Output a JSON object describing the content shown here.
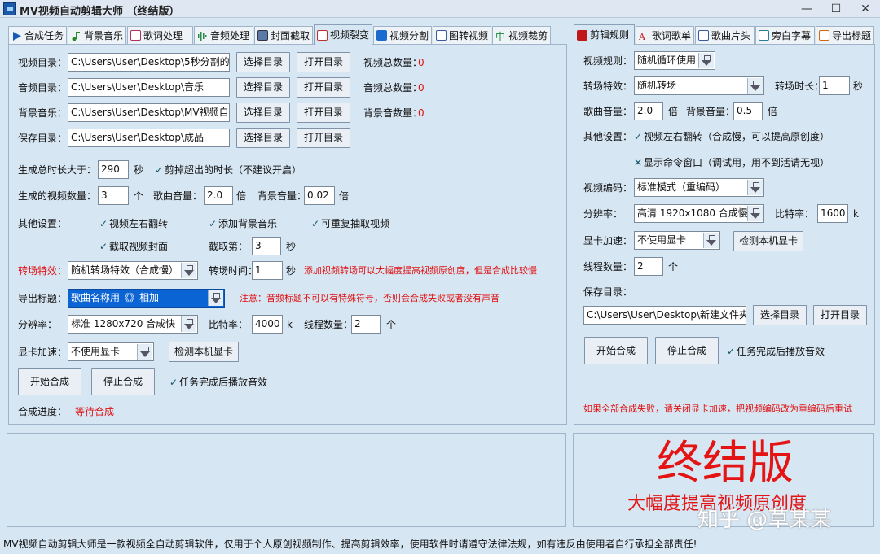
{
  "window": {
    "title": "MV视频自动剪辑大师 （终结版）",
    "min": "—",
    "max": "☐",
    "close": "✕"
  },
  "left_tabs": [
    "合成任务",
    "背景音乐",
    "歌词处理",
    "音频处理",
    "封面截取",
    "视频裂变",
    "视频分割",
    "图转视频",
    "视频裁剪"
  ],
  "right_tabs": [
    "剪辑规则",
    "歌词歌单",
    "歌曲片头",
    "旁白字幕",
    "导出标题"
  ],
  "colors": {
    "accent_red": "#e01010",
    "panel_bg": "#d7e6f3",
    "selection": "#0a64d4"
  },
  "left": {
    "video_dir_label": "视频目录：",
    "video_dir": "C:\\Users\\User\\Desktop\\5秒分割的视",
    "audio_dir_label": "音频目录：",
    "audio_dir": "C:\\Users\\User\\Desktop\\音乐",
    "bg_music_label": "背景音乐：",
    "bg_music_dir": "C:\\Users\\User\\Desktop\\MV视频自动",
    "save_dir_label": "保存目录：",
    "save_dir": "C:\\Users\\User\\Desktop\\成品",
    "select_dir": "选择目录",
    "open_dir": "打开目录",
    "video_total_label": "视频总数量：",
    "video_total": "0",
    "audio_total_label": "音频总数量：",
    "audio_total": "0",
    "bg_total_label": "背景音数量：",
    "bg_total": "0",
    "duration_label": "生成总时长大于：",
    "duration": "290",
    "sec": "秒",
    "trim_excess": "剪掉超出的时长（不建议开启）",
    "video_count_label": "生成的视频数量：",
    "video_count": "3",
    "unit_ge": "个",
    "song_vol_label": "歌曲音量：",
    "song_vol": "2.0",
    "bei": "倍",
    "bg_vol_label": "背景音量：",
    "bg_vol": "0.02",
    "other_label": "其他设置：",
    "flip": "视频左右翻转",
    "add_bg": "添加背景音乐",
    "repeat": "可重复抽取视频",
    "cover": "截取视频封面",
    "cut_frame_label": "截取第：",
    "cut_frame": "3",
    "transition_label": "转场特效：",
    "transition": "随机转场特效（合成慢）",
    "transition_time_label": "转场时间：",
    "transition_time": "1",
    "transition_note": "添加视频转场可以大幅度提高视频原创度，但是合成比较慢",
    "export_title_label": "导出标题：",
    "export_title": "歌曲名称用《》相加",
    "title_note": "注意：音频标题不可以有特殊符号，否则会合成失败或者没有声音",
    "resolution_label": "分辨率：",
    "resolution": "标准 1280x720  合成快",
    "bitrate_label": "比特率：",
    "bitrate": "4000",
    "k": "k",
    "threads_label": "线程数量：",
    "threads": "2",
    "gpu_label": "显卡加速：",
    "gpu": "不使用显卡",
    "detect_gpu": "检测本机显卡",
    "start": "开始合成",
    "stop": "停止合成",
    "sound_done": "任务完成后播放音效",
    "progress_label": "合成进度：",
    "progress": "等待合成"
  },
  "right": {
    "video_rule_label": "视频规则：",
    "video_rule": "随机循环使用",
    "transition_label": "转场特效：",
    "transition": "随机转场",
    "transition_len_label": "转场时长：",
    "transition_len": "1",
    "sec": "秒",
    "song_vol_label": "歌曲音量：",
    "song_vol": "2.0",
    "bei": "倍",
    "bg_vol_label": "背景音量：",
    "bg_vol": "0.5",
    "other_label": "其他设置：",
    "flip": "视频左右翻转（合成慢，可以提高原创度）",
    "show_cmd": "显示命令窗口（调试用，用不到活请无视）",
    "encode_label": "视频编码：",
    "encode": "标准模式（重编码）",
    "resolution_label": "分辨率：",
    "resolution": "高清 1920x1080 合成慢",
    "bitrate_label": "比特率：",
    "bitrate": "1600",
    "k": "k",
    "gpu_label": "显卡加速：",
    "gpu": "不使用显卡",
    "detect_gpu": "检测本机显卡",
    "threads_label": "线程数量：",
    "threads": "2",
    "unit_ge": "个",
    "save_label": "保存目录：",
    "save_dir": "C:\\Users\\User\\Desktop\\新建文件夹 (",
    "select_dir": "选择目录",
    "open_dir": "打开目录",
    "start": "开始合成",
    "stop": "停止合成",
    "sound_done": "任务完成后播放音效",
    "fail_note": "如果全部合成失败，请关闭显卡加速，把视频编码改为重编码后重试"
  },
  "promo": {
    "title": "终结版",
    "subtitle": "大幅度提高视频原创度",
    "watermark": "知乎 @草某某"
  },
  "status_bar": "MV视频自动剪辑大师是一款视频全自动剪辑软件，仅用于个人原创视频制作、提高剪辑效率，使用软件时请遵守法律法规，如有违反由使用者自行承担全部责任!"
}
